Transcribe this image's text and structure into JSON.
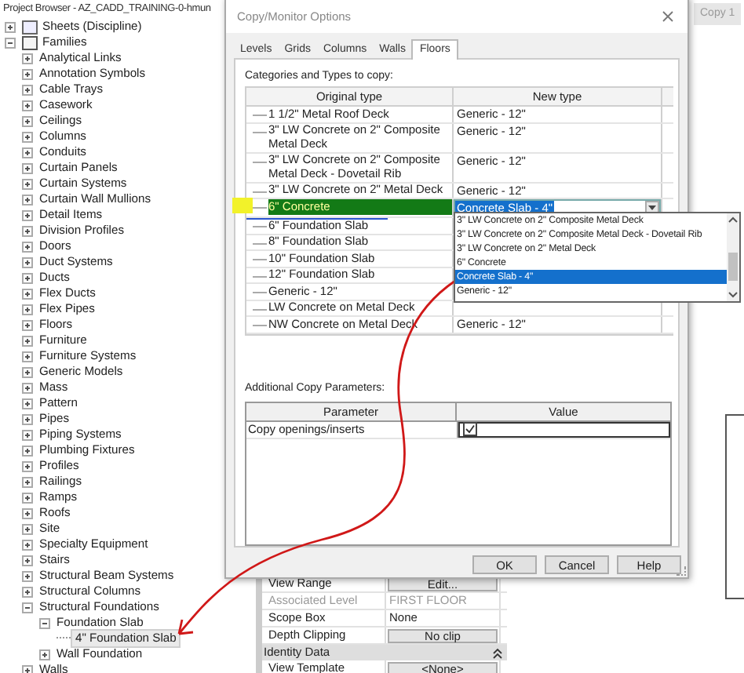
{
  "project_browser": {
    "title": "Project Browser - AZ_CADD_TRAINING-0-hmun",
    "items": [
      {
        "label": "Sheets (Discipline)",
        "kind": "sheets",
        "expanded": false,
        "selected": false
      },
      {
        "label": "Families",
        "kind": "families",
        "expanded": true,
        "selected": false,
        "children": [
          {
            "label": "Analytical Links",
            "expanded": false,
            "selected": false
          },
          {
            "label": "Annotation Symbols",
            "expanded": false,
            "selected": false
          },
          {
            "label": "Cable Trays",
            "expanded": false,
            "selected": false
          },
          {
            "label": "Casework",
            "expanded": false,
            "selected": false
          },
          {
            "label": "Ceilings",
            "expanded": false,
            "selected": false
          },
          {
            "label": "Columns",
            "expanded": false,
            "selected": false
          },
          {
            "label": "Conduits",
            "expanded": false,
            "selected": false
          },
          {
            "label": "Curtain Panels",
            "expanded": false,
            "selected": false
          },
          {
            "label": "Curtain Systems",
            "expanded": false,
            "selected": false
          },
          {
            "label": "Curtain Wall Mullions",
            "expanded": false,
            "selected": false
          },
          {
            "label": "Detail Items",
            "expanded": false,
            "selected": false
          },
          {
            "label": "Division Profiles",
            "expanded": false,
            "selected": false
          },
          {
            "label": "Doors",
            "expanded": false,
            "selected": false
          },
          {
            "label": "Duct Systems",
            "expanded": false,
            "selected": false
          },
          {
            "label": "Ducts",
            "expanded": false,
            "selected": false
          },
          {
            "label": "Flex Ducts",
            "expanded": false,
            "selected": false
          },
          {
            "label": "Flex Pipes",
            "expanded": false,
            "selected": false
          },
          {
            "label": "Floors",
            "expanded": false,
            "selected": false
          },
          {
            "label": "Furniture",
            "expanded": false,
            "selected": false
          },
          {
            "label": "Furniture Systems",
            "expanded": false,
            "selected": false
          },
          {
            "label": "Generic Models",
            "expanded": false,
            "selected": false
          },
          {
            "label": "Mass",
            "expanded": false,
            "selected": false
          },
          {
            "label": "Pattern",
            "expanded": false,
            "selected": false
          },
          {
            "label": "Pipes",
            "expanded": false,
            "selected": false
          },
          {
            "label": "Piping Systems",
            "expanded": false,
            "selected": false
          },
          {
            "label": "Plumbing Fixtures",
            "expanded": false,
            "selected": false
          },
          {
            "label": "Profiles",
            "expanded": false,
            "selected": false
          },
          {
            "label": "Railings",
            "expanded": false,
            "selected": false
          },
          {
            "label": "Ramps",
            "expanded": false,
            "selected": false
          },
          {
            "label": "Roofs",
            "expanded": false,
            "selected": false
          },
          {
            "label": "Site",
            "expanded": false,
            "selected": false
          },
          {
            "label": "Specialty Equipment",
            "expanded": false,
            "selected": false
          },
          {
            "label": "Stairs",
            "expanded": false,
            "selected": false
          },
          {
            "label": "Structural Beam Systems",
            "expanded": false,
            "selected": false
          },
          {
            "label": "Structural Columns",
            "expanded": false,
            "selected": false
          },
          {
            "label": "Structural Foundations",
            "expanded": true,
            "selected": false,
            "children": [
              {
                "label": "Foundation Slab",
                "expanded": true,
                "selected": false,
                "children": [
                  {
                    "label": "4\" Foundation Slab",
                    "selected": true
                  }
                ]
              },
              {
                "label": "Wall Foundation",
                "expanded": false,
                "selected": false
              }
            ]
          },
          {
            "label": "Walls",
            "expanded": false,
            "selected": false
          }
        ]
      }
    ]
  },
  "view_tab": {
    "label": "Copy 1"
  },
  "properties": {
    "rows": [
      {
        "kind": "button",
        "label": "View Range",
        "value": "Edit...",
        "disabled": false
      },
      {
        "kind": "text",
        "label": "Associated Level",
        "value": "FIRST FLOOR",
        "disabled": true
      },
      {
        "kind": "text",
        "label": "Scope Box",
        "value": "None",
        "disabled": false
      },
      {
        "kind": "button",
        "label": "Depth Clipping",
        "value": "No clip",
        "disabled": false
      },
      {
        "kind": "group",
        "label": "Identity Data",
        "expanded": true
      },
      {
        "kind": "button",
        "label": "View Template",
        "value": "<None>",
        "disabled": false
      }
    ]
  },
  "dialog": {
    "title": "Copy/Monitor Options",
    "tabs": [
      {
        "label": "Levels",
        "selected": false
      },
      {
        "label": "Grids",
        "selected": false
      },
      {
        "label": "Columns",
        "selected": false
      },
      {
        "label": "Walls",
        "selected": false
      },
      {
        "label": "Floors",
        "selected": true
      }
    ],
    "types_label": "Categories and Types to copy:",
    "types_table": {
      "columns": [
        "Original type",
        "New type"
      ],
      "rows": [
        {
          "original": "1 1/2\" Metal Roof Deck",
          "new_type": "Generic - 12\"",
          "selected": false
        },
        {
          "original": "3\" LW Concrete on 2\" Composite Metal Deck",
          "new_type": "Generic - 12\"",
          "selected": false
        },
        {
          "original": "3\" LW Concrete on 2\" Composite Metal Deck - Dovetail Rib",
          "new_type": "Generic - 12\"",
          "selected": false
        },
        {
          "original": "3\" LW Concrete on 2\" Metal Deck",
          "new_type": "Generic - 12\"",
          "selected": false
        },
        {
          "original": "6\" Concrete",
          "new_type": "Concrete Slab - 4\"",
          "selected": true
        },
        {
          "original": "6\" Foundation Slab",
          "selected": false
        },
        {
          "original": "8\" Foundation Slab",
          "selected": false
        },
        {
          "original": "10\" Foundation Slab",
          "selected": false
        },
        {
          "original": "12\" Foundation Slab",
          "selected": false
        },
        {
          "original": "Generic - 12\"",
          "selected": false
        },
        {
          "original": "LW Concrete on Metal Deck",
          "selected": false
        },
        {
          "original": "NW Concrete on Metal Deck",
          "new_type": "Generic - 12\"",
          "selected": false
        }
      ]
    },
    "dropdown": {
      "items": [
        {
          "label": "3\" LW Concrete on 2\" Composite Metal Deck",
          "selected": false
        },
        {
          "label": "3\" LW Concrete on 2\" Composite Metal Deck - Dovetail Rib",
          "selected": false
        },
        {
          "label": "3\" LW Concrete on 2\" Metal Deck",
          "selected": false
        },
        {
          "label": "6\" Concrete",
          "selected": false
        },
        {
          "label": "Concrete Slab - 4\"",
          "selected": true
        },
        {
          "label": "Generic - 12\"",
          "selected": false
        }
      ]
    },
    "params_label": "Additional Copy Parameters:",
    "params_table": {
      "columns": [
        "Parameter",
        "Value"
      ],
      "rows": [
        {
          "parameter": "Copy openings/inserts",
          "checked": true
        }
      ]
    },
    "buttons": [
      "OK",
      "Cancel",
      "Help"
    ]
  }
}
